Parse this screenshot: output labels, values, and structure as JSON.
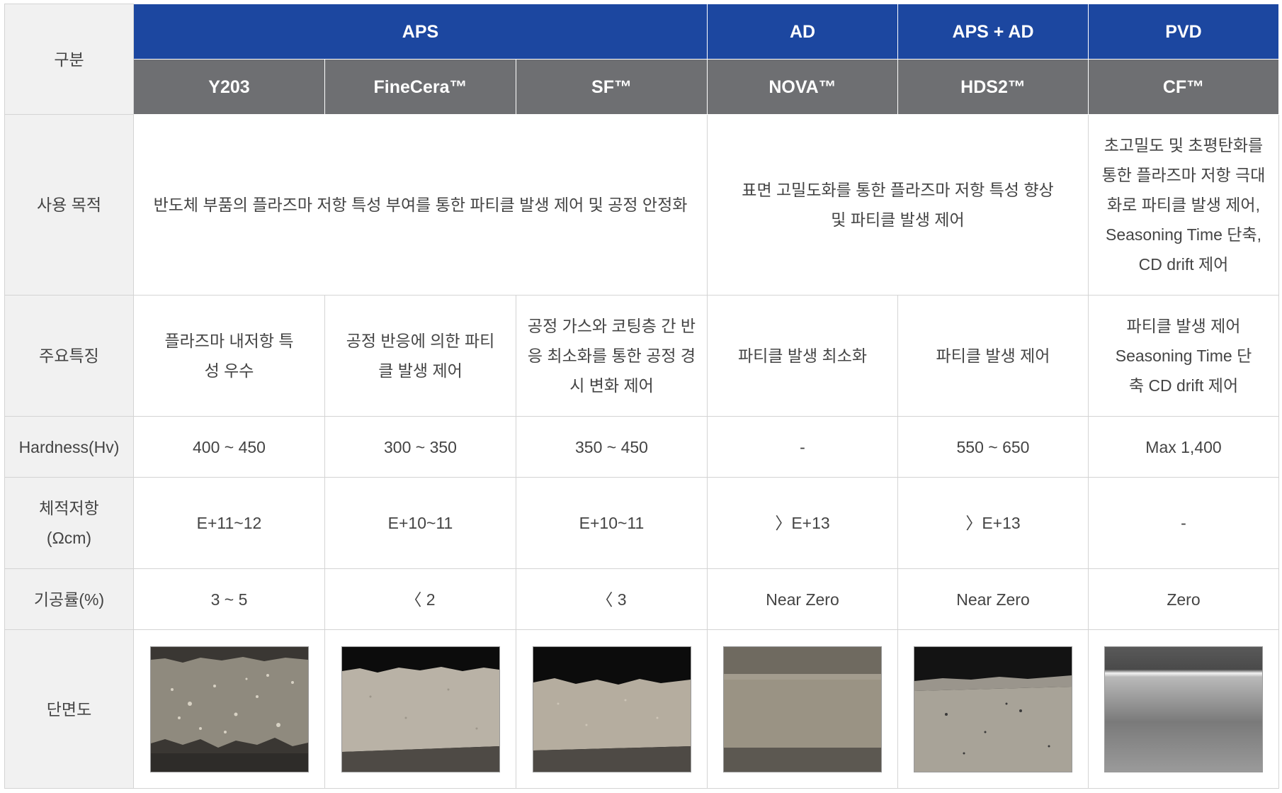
{
  "header": {
    "category_label": "구분",
    "categories": [
      "APS",
      "AD",
      "APS + AD",
      "PVD"
    ],
    "products": [
      "Y203",
      "FineCera™",
      "SF™",
      "NOVA™",
      "HDS2™",
      "CF™"
    ]
  },
  "rows": {
    "purpose": {
      "label": "사용 목적",
      "aps": "반도체 부품의 플라즈마 저항 특성 부여를 통한 파티클 발생 제어 및 공정 안정화",
      "ad": "표면 고밀도화를 통한 플라즈마 저항 특성 향상 및 파티클 발생 제어",
      "pvd": "초고밀도 및 초평탄화를 통한 플라즈마 저항 극대화로 파티클 발생 제어, Seasoning Time 단축, CD drift 제어"
    },
    "feature": {
      "label": "주요특징",
      "values": [
        "플라즈마 내저항 특성 우수",
        "공정 반응에 의한 파티클 발생 제어",
        "공정 가스와 코팅층 간 반응 최소화를 통한 공정 경시 변화 제어",
        "파티클 발생 최소화",
        "파티클 발생 제어",
        "파티클 발생 제어Seasoning Time 단축 CD drift 제어"
      ]
    },
    "hardness": {
      "label": "Hardness(Hv)",
      "values": [
        "400 ~ 450",
        "300 ~ 350",
        "350 ~ 450",
        "-",
        "550 ~ 650",
        "Max 1,400"
      ]
    },
    "resistivity": {
      "label_line1": "체적저항",
      "label_line2": "(Ωcm)",
      "values": [
        "E+11~12",
        "E+10~11",
        "E+10~11",
        "〉E+13",
        "〉E+13",
        "-"
      ]
    },
    "porosity": {
      "label": "기공률(%)",
      "values": [
        "3 ~ 5",
        "〈 2",
        "〈 3",
        "Near Zero",
        "Near Zero",
        "Zero"
      ]
    },
    "cross_section": {
      "label": "단면도",
      "images": [
        "cross-section-y203-image",
        "cross-section-finecera-image",
        "cross-section-sf-image",
        "cross-section-nova-image",
        "cross-section-hds2-image",
        "cross-section-cf-image"
      ]
    }
  },
  "colors": {
    "category_header_bg": "#1c47a0",
    "product_header_bg": "#6e6f72",
    "row_label_bg": "#f1f1f1",
    "border": "#d4d4d4"
  }
}
